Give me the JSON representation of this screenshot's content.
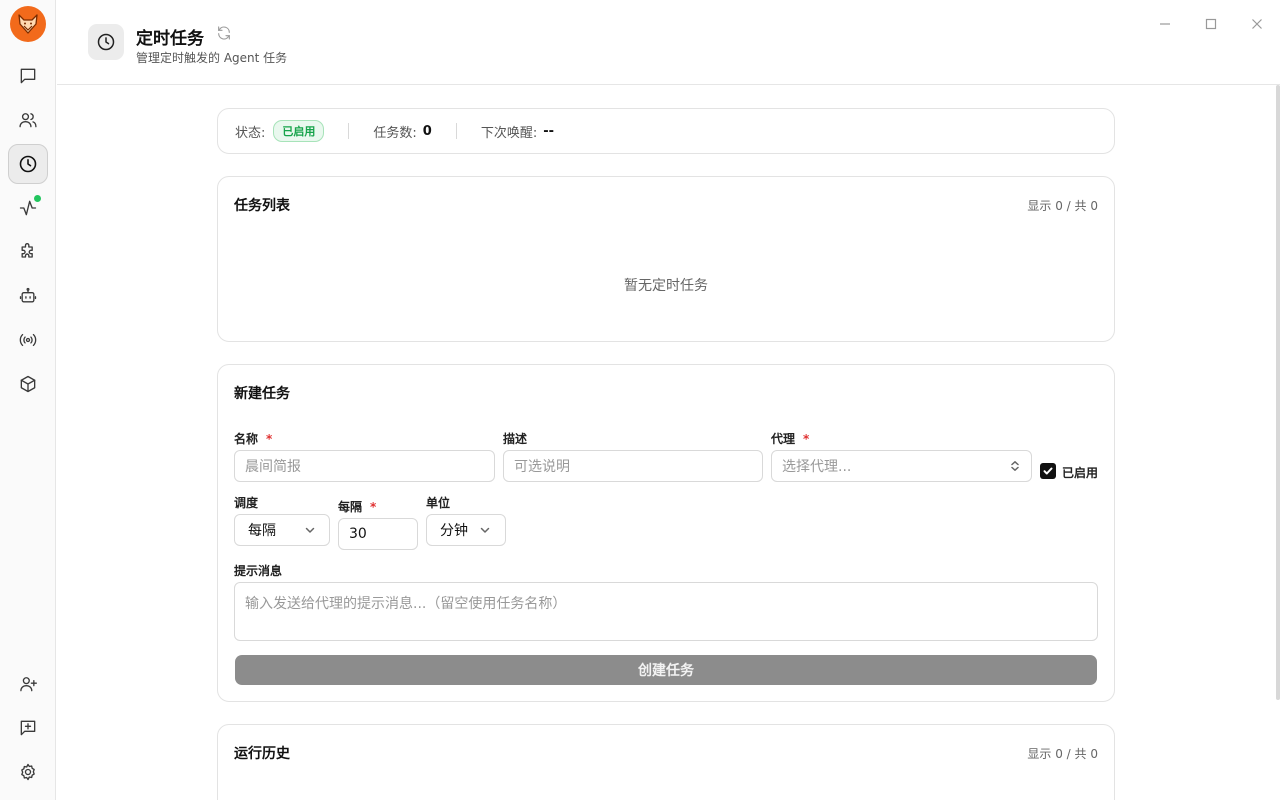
{
  "app": {
    "title": "定时任务",
    "subtitle": "管理定时触发的 Agent 任务"
  },
  "sidebar": {
    "top_items": [
      {
        "icon": "chat-icon"
      },
      {
        "icon": "users-icon"
      },
      {
        "icon": "clock-icon",
        "active": true
      },
      {
        "icon": "activity-icon",
        "status_dot": true
      },
      {
        "icon": "puzzle-icon"
      },
      {
        "icon": "bot-icon"
      },
      {
        "icon": "broadcast-icon"
      },
      {
        "icon": "package-icon"
      }
    ],
    "bottom_items": [
      {
        "icon": "user-plus-icon"
      },
      {
        "icon": "message-plus-icon"
      },
      {
        "icon": "gear-icon"
      }
    ]
  },
  "status": {
    "state_label": "状态:",
    "state_value": "已启用",
    "count_label": "任务数:",
    "count_value": "0",
    "next_label": "下次唤醒:",
    "next_value": "--"
  },
  "task_list": {
    "title": "任务列表",
    "count_text": "显示 0 / 共 0",
    "empty_text": "暂无定时任务"
  },
  "new_task": {
    "title": "新建任务",
    "name_label": "名称",
    "name_placeholder": "晨间简报",
    "desc_label": "描述",
    "desc_placeholder": "可选说明",
    "agent_label": "代理",
    "agent_placeholder": "选择代理...",
    "enabled_label": "已启用",
    "enabled": true,
    "schedule_label": "调度",
    "schedule_value": "每隔",
    "interval_label": "每隔",
    "interval_value": "30",
    "unit_label": "单位",
    "unit_value": "分钟",
    "prompt_label": "提示消息",
    "prompt_placeholder": "输入发送给代理的提示消息...（留空使用任务名称）",
    "submit_label": "创建任务",
    "required_mark": "*"
  },
  "history": {
    "title": "运行历史",
    "count_text": "显示 0 / 共 0"
  },
  "colors": {
    "accent_orange": "#f26a1b",
    "enabled_green": "#16a34a",
    "required_red": "#e03131",
    "disabled_button": "#8c8c8c"
  }
}
